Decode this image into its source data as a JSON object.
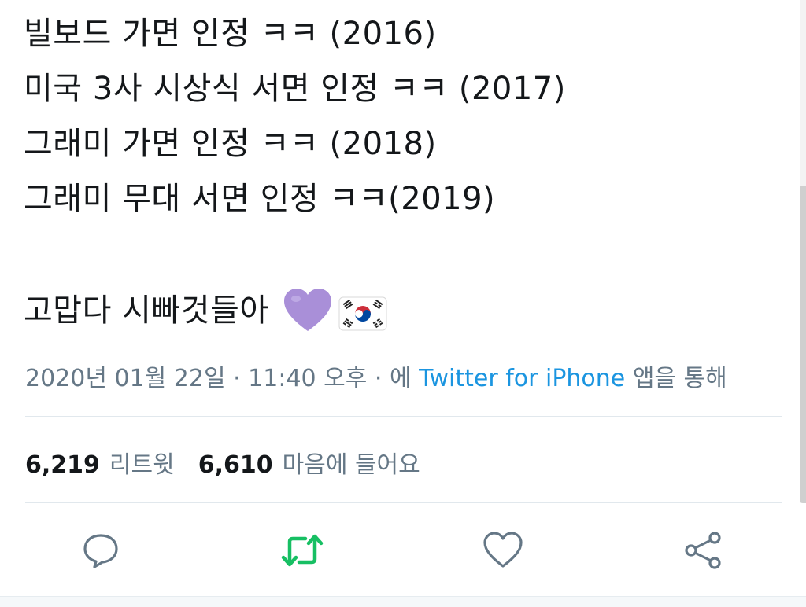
{
  "tweet": {
    "lines": [
      "빌보드 가면 인정 ㅋㅋ (2016)",
      "미국 3사 시상식 서면 인정 ㅋㅋ (2017)",
      "그래미 가면 인정 ㅋㅋ (2018)",
      "그래미 무대 서면 인정 ㅋㅋ(2019)"
    ],
    "closing_text": "고맙다 시빠것들아",
    "emojis": [
      "purple-heart",
      "south-korea-flag"
    ],
    "colors": {
      "heart": "#a98fd8",
      "text": "#14171a"
    }
  },
  "meta": {
    "datetime": "2020년 01월 22일 · 11:40 오후 · 에",
    "source": "Twitter for iPhone",
    "suffix": "앱을 통해",
    "colors": {
      "meta": "#657786",
      "link": "#1b95e0"
    }
  },
  "stats": {
    "retweets_count": "6,219",
    "retweets_label": "리트윗",
    "likes_count": "6,610",
    "likes_label": "마음에 들어요"
  },
  "actions": {
    "icons": [
      "reply-icon",
      "retweet-icon",
      "like-icon",
      "share-icon"
    ],
    "colors": {
      "default": "#657786",
      "retweet_active": "#17bf63"
    }
  }
}
